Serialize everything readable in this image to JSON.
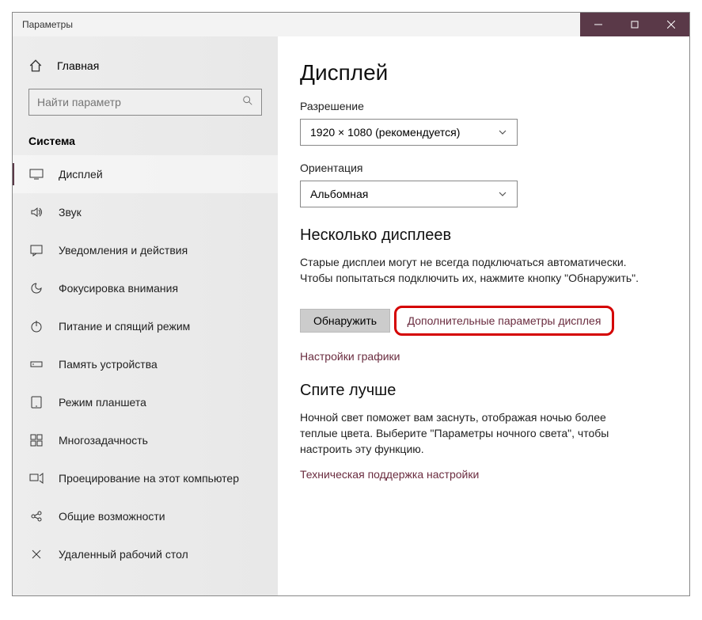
{
  "window": {
    "title": "Параметры"
  },
  "home": {
    "label": "Главная"
  },
  "search": {
    "placeholder": "Найти параметр"
  },
  "section": {
    "label": "Система"
  },
  "nav": [
    {
      "label": "Дисплей",
      "icon": "display"
    },
    {
      "label": "Звук",
      "icon": "sound"
    },
    {
      "label": "Уведомления и действия",
      "icon": "notifications"
    },
    {
      "label": "Фокусировка внимания",
      "icon": "focus"
    },
    {
      "label": "Питание и спящий режим",
      "icon": "power"
    },
    {
      "label": "Память устройства",
      "icon": "storage"
    },
    {
      "label": "Режим планшета",
      "icon": "tablet"
    },
    {
      "label": "Многозадачность",
      "icon": "multitask"
    },
    {
      "label": "Проецирование на этот компьютер",
      "icon": "project"
    },
    {
      "label": "Общие возможности",
      "icon": "shared"
    },
    {
      "label": "Удаленный рабочий стол",
      "icon": "remote"
    }
  ],
  "page": {
    "title": "Дисплей",
    "resolution_label": "Разрешение",
    "resolution_value": "1920 × 1080 (рекомендуется)",
    "orientation_label": "Ориентация",
    "orientation_value": "Альбомная",
    "multi_title": "Несколько дисплеев",
    "multi_para": "Старые дисплеи могут не всегда подключаться автоматически. Чтобы попытаться подключить их, нажмите кнопку \"Обнаружить\".",
    "detect_btn": "Обнаружить",
    "adv_link": "Дополнительные параметры дисплея",
    "gfx_link": "Настройки графики",
    "sleep_title": "Спите лучше",
    "sleep_para": "Ночной свет поможет вам заснуть, отображая ночью более теплые цвета. Выберите \"Параметры ночного света\", чтобы настроить эту функцию.",
    "support_link": "Техническая поддержка настройки"
  }
}
